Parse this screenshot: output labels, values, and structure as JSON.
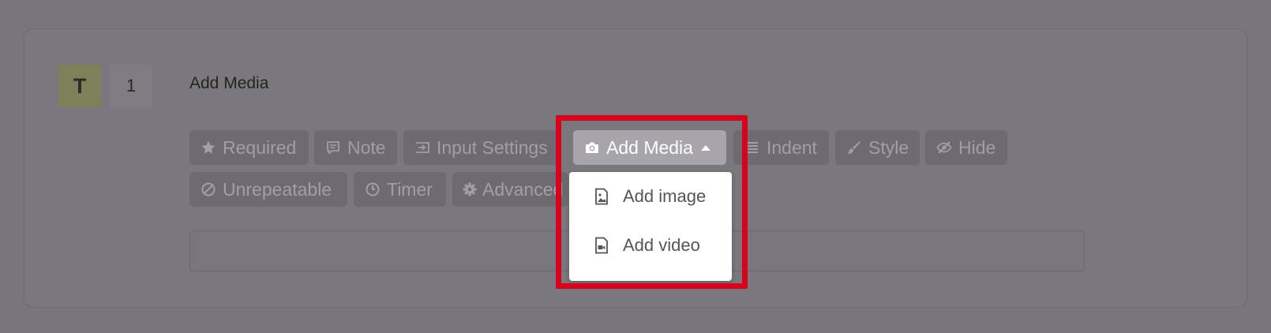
{
  "question": {
    "type_badge": "T",
    "number": "1",
    "title": "Add Media"
  },
  "toolbar": {
    "required": "Required",
    "note": "Note",
    "input_settings": "Input Settings",
    "add_media": "Add Media",
    "indent": "Indent",
    "style": "Style",
    "hide": "Hide",
    "unrepeatable": "Unrepeatable",
    "timer": "Timer",
    "advanced": "Advanced"
  },
  "media_menu": {
    "add_image": "Add image",
    "add_video": "Add video"
  },
  "colors": {
    "highlight": "#d8001a",
    "overlay": "#78767a"
  }
}
